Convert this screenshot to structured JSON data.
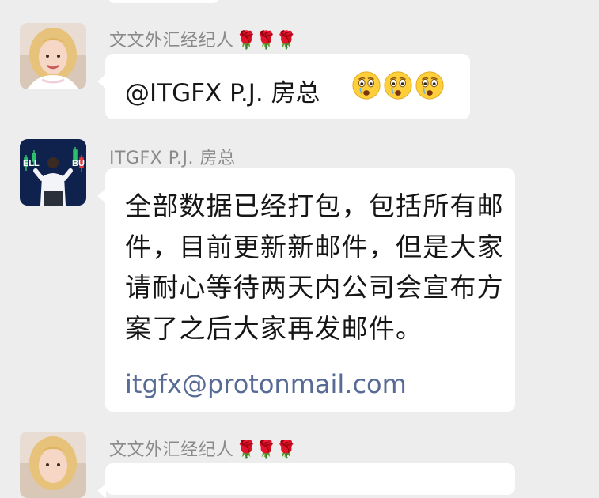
{
  "messages": [
    {
      "sender": "文文外汇经纪人",
      "sender_badge": "🌹🌹🌹",
      "text": "@ITGFX P.J. 房总",
      "emoji": [
        "astonished-face",
        "astonished-face",
        "astonished-face"
      ]
    },
    {
      "sender": "ITGFX P.J. 房总",
      "text": "全部数据已经打包，包括所有邮件，目前更新新邮件，但是大家请耐心等待两天内公司会宣布方案了之后大家再发邮件。",
      "link": "itgfx@protonmail.com"
    },
    {
      "sender": "文文外汇经纪人",
      "sender_badge": "🌹🌹🌹",
      "text": ""
    }
  ],
  "colors": {
    "background": "#ededed",
    "bubble": "#ffffff",
    "sender_name": "#8a8a8a",
    "link": "#576b95",
    "rose": "#d0202a"
  }
}
